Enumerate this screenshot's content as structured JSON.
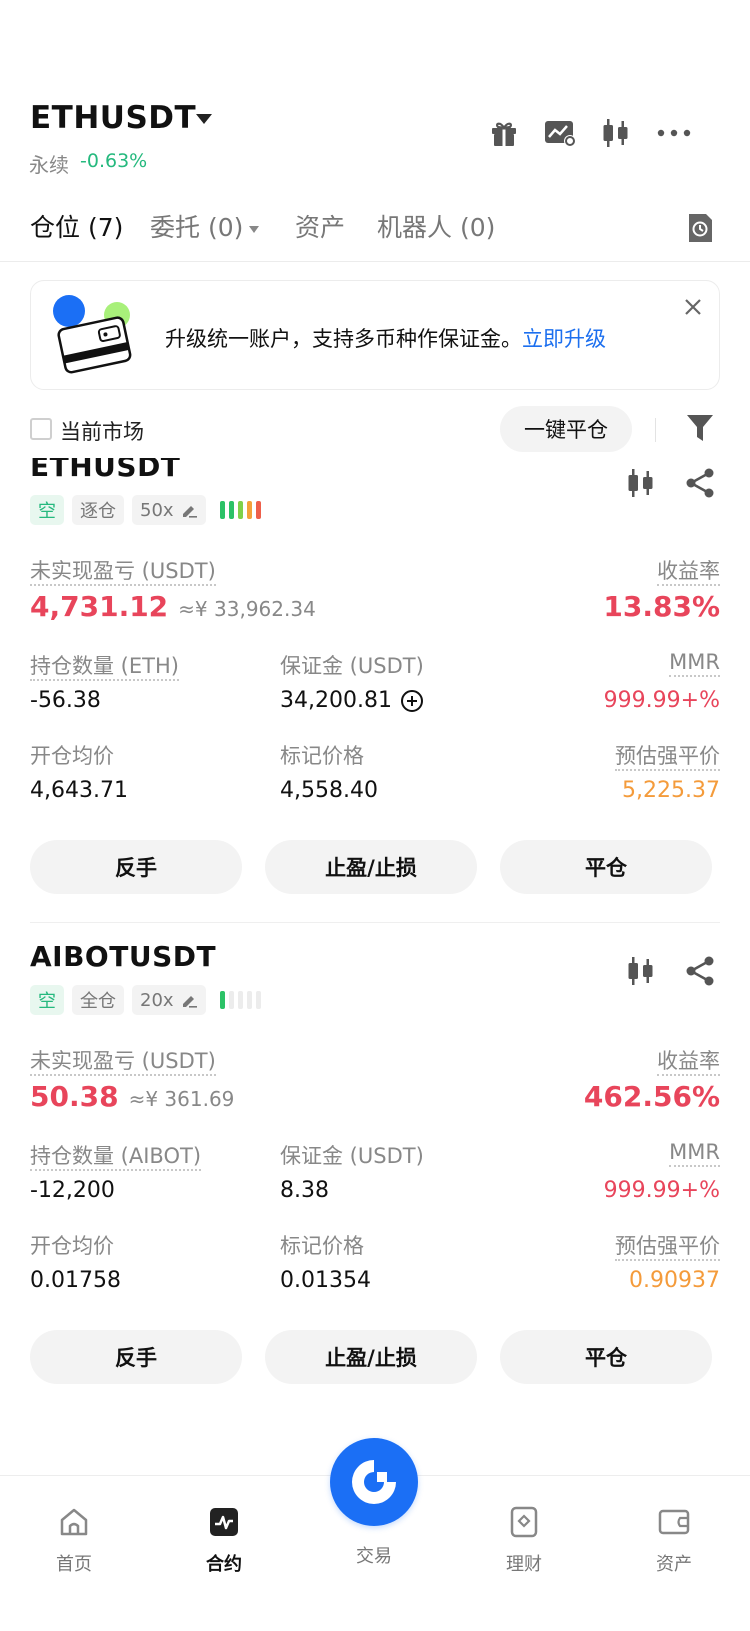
{
  "header": {
    "pair": "ETHUSDT",
    "contract_type": "永续",
    "change": "-0.63%",
    "icons": [
      "gift-icon",
      "chart-settings-icon",
      "candlestick-icon",
      "more-icon"
    ]
  },
  "tabs": [
    {
      "label": "仓位 (7)",
      "active": true
    },
    {
      "label": "委托 (0)",
      "active": false,
      "dropdown": true
    },
    {
      "label": "资产",
      "active": false
    },
    {
      "label": "机器人 (0)",
      "active": false
    }
  ],
  "banner": {
    "text": "升级统一账户，支持多币种作保证金。",
    "link": "立即升级"
  },
  "filter": {
    "checkbox_label": "当前市场",
    "close_all": "一键平仓"
  },
  "positions": [
    {
      "symbol": "ETHUSDT",
      "side": "空",
      "margin_mode": "逐仓",
      "leverage": "50x",
      "risk_bars": 5,
      "pnl_label": "未实现盈亏 (USDT)",
      "pnl": "4,731.12",
      "pnl_cny": "≈¥ 33,962.34",
      "roe_label": "收益率",
      "roe": "13.83%",
      "qty_label": "持仓数量 (ETH)",
      "qty": "-56.38",
      "margin_label": "保证金 (USDT)",
      "margin": "34,200.81",
      "mmr_label": "MMR",
      "mmr": "999.99+%",
      "entry_label": "开仓均价",
      "entry": "4,643.71",
      "mark_label": "标记价格",
      "mark": "4,558.40",
      "liq_label": "预估强平价",
      "liq": "5,225.37",
      "actions": [
        "反手",
        "止盈/止损",
        "平仓"
      ]
    },
    {
      "symbol": "AIBOTUSDT",
      "side": "空",
      "margin_mode": "全仓",
      "leverage": "20x",
      "risk_bars": 1,
      "pnl_label": "未实现盈亏 (USDT)",
      "pnl": "50.38",
      "pnl_cny": "≈¥ 361.69",
      "roe_label": "收益率",
      "roe": "462.56%",
      "qty_label": "持仓数量 (AIBOT)",
      "qty": "-12,200",
      "margin_label": "保证金 (USDT)",
      "margin": "8.38",
      "mmr_label": "MMR",
      "mmr": "999.99+%",
      "entry_label": "开仓均价",
      "entry": "0.01758",
      "mark_label": "标记价格",
      "mark": "0.01354",
      "liq_label": "预估强平价",
      "liq": "0.90937",
      "actions": [
        "反手",
        "止盈/止损",
        "平仓"
      ]
    }
  ],
  "bottom_nav": [
    {
      "label": "首页",
      "icon": "home-icon",
      "active": false
    },
    {
      "label": "合约",
      "icon": "futures-icon",
      "active": true
    },
    {
      "label": "交易",
      "icon": "trade-icon",
      "active": false
    },
    {
      "label": "理财",
      "icon": "earn-icon",
      "active": false
    },
    {
      "label": "资产",
      "icon": "wallet-icon",
      "active": false
    }
  ],
  "colors": {
    "accent": "#1b6ff5",
    "profit_red": "#e8455b",
    "up_green": "#25b97e",
    "liq_orange": "#f49b3b"
  }
}
